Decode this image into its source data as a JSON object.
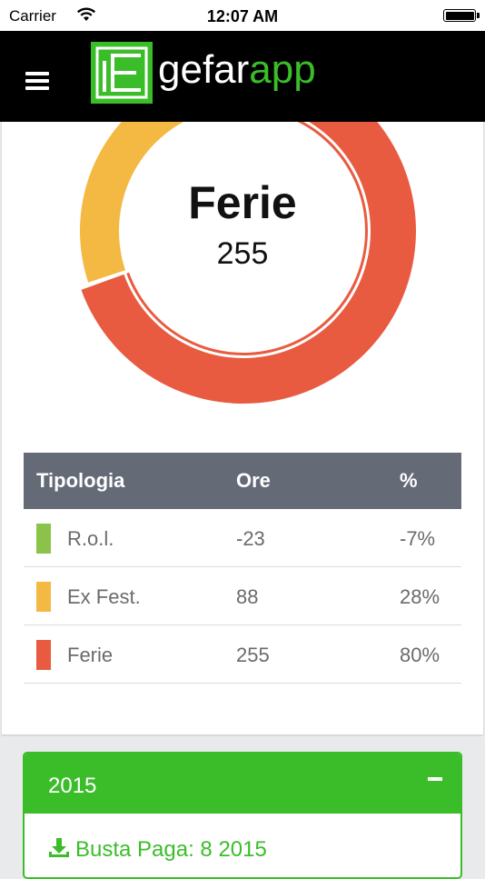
{
  "status_bar": {
    "carrier": "Carrier",
    "time": "12:07 AM"
  },
  "header": {
    "logo_text_white": "gefar",
    "logo_text_green": "app",
    "menu_icon": "hamburger-icon",
    "logo_icon": "gefarapp-logo-icon"
  },
  "chart_data": {
    "type": "donut",
    "center_label": "Ferie",
    "center_value": "255",
    "slices": [
      {
        "label": "R.o.l.",
        "value": -23,
        "color": "#8bc34a"
      },
      {
        "label": "Ex Fest.",
        "value": 88,
        "color": "#f4b942"
      },
      {
        "label": "Ferie",
        "value": 255,
        "color": "#e95b40"
      }
    ]
  },
  "table": {
    "headers": [
      "Tipologia",
      "Ore",
      "%"
    ],
    "rows": [
      {
        "name": "R.o.l.",
        "ore": "-23",
        "pct": "-7%",
        "color": "#8bc34a"
      },
      {
        "name": "Ex Fest.",
        "ore": "88",
        "pct": "28%",
        "color": "#f4b942"
      },
      {
        "name": "Ferie",
        "ore": "255",
        "pct": "80%",
        "color": "#e95b40"
      }
    ]
  },
  "year_panel": {
    "year": "2015",
    "toggle_icon": "minus-icon",
    "link_icon": "download-icon",
    "payslip_label": "Busta Paga: 8 2015"
  },
  "colors": {
    "accent_green": "#3bbd2a",
    "header_bg": "#000000",
    "table_head_bg": "#646b77"
  }
}
